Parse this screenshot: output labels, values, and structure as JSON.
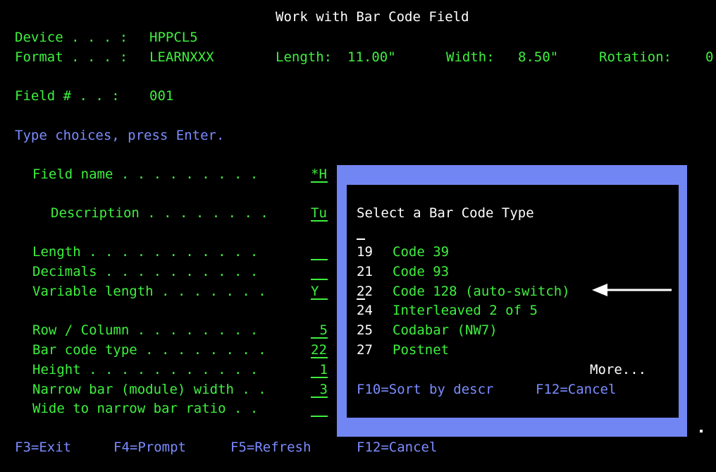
{
  "header": {
    "title": "Work with Bar Code Field",
    "device_label": "Device . . . :",
    "device_value": "HPPCL5",
    "format_label": "Format . . . :",
    "format_value": "LEARNXXX",
    "length_label": "Length:",
    "length_value": "11.00\"",
    "width_label": "Width:",
    "width_value": "8.50\"",
    "rotation_label": "Rotation:",
    "rotation_value": "0",
    "field_label": "Field # . . :",
    "field_value": "001",
    "instruction": "Type choices, press Enter."
  },
  "fields": [
    {
      "label": "Field name . . . . . . . . .",
      "value": "*H"
    },
    {
      "label": "Description . . . . . . . .",
      "value": "Tu"
    },
    {
      "label": "Length . . . . . . . . . . .",
      "value": ""
    },
    {
      "label": "Decimals . . . . . . . . . .",
      "value": ""
    },
    {
      "label": "Variable length . . . . . . .",
      "value": "Y"
    },
    {
      "label": "Row / Column . . . . . . . .",
      "value": "5"
    },
    {
      "label": "Bar code type . . . . . . . .",
      "value": "22"
    },
    {
      "label": "Height . . . . . . . . . . .",
      "value": "1"
    },
    {
      "label": "Narrow bar (module) width . .",
      "value": "3"
    },
    {
      "label": "Wide to narrow bar ratio . .",
      "value": ""
    }
  ],
  "popup": {
    "title": "Select a Bar Code Type",
    "items": [
      {
        "code": "19",
        "label": "Code 39"
      },
      {
        "code": "21",
        "label": "Code 93"
      },
      {
        "code": "22",
        "label": "Code 128 (auto-switch)"
      },
      {
        "code": "24",
        "label": "Interleaved 2 of 5"
      },
      {
        "code": "25",
        "label": "Codabar (NW7)"
      },
      {
        "code": "27",
        "label": "Postnet"
      }
    ],
    "more": "More...",
    "f10": "F10=Sort by descr",
    "f12": "F12=Cancel"
  },
  "footer": {
    "f3": "F3=Exit",
    "f4": "F4=Prompt",
    "f5": "F5=Refresh",
    "f12": "F12=Cancel"
  },
  "colors": {
    "background": "#000000",
    "text_green": "#3ef03e",
    "text_blue": "#7b8cff",
    "text_white": "#ffffff",
    "window_border": "#7186f2"
  }
}
